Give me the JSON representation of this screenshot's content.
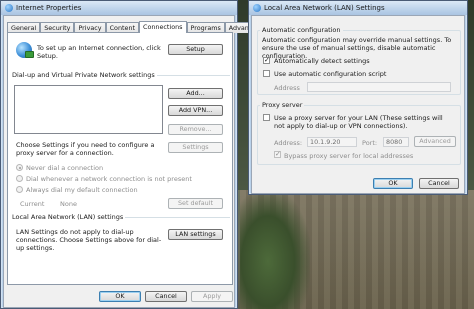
{
  "left_window": {
    "title": "Internet Properties",
    "tabs": [
      "General",
      "Security",
      "Privacy",
      "Content",
      "Connections",
      "Programs",
      "Advanced"
    ],
    "active_tab": "Connections",
    "setup_text": "To set up an Internet connection, click Setup.",
    "setup_button": "Setup",
    "dialup_group": "Dial-up and Virtual Private Network settings",
    "add_button": "Add...",
    "add_vpn_button": "Add VPN...",
    "remove_button": "Remove...",
    "settings_button": "Settings",
    "proxy_note": "Choose Settings if you need to configure a proxy server for a connection.",
    "radio_never": "Never dial a connection",
    "radio_dial_whenever": "Dial whenever a network connection is not present",
    "radio_always": "Always dial my default connection",
    "current_label": "Current",
    "current_value": "None",
    "set_default_button": "Set default",
    "lan_group": "Local Area Network (LAN) settings",
    "lan_note": "LAN Settings do not apply to dial-up connections. Choose Settings above for dial-up settings.",
    "lan_settings_button": "LAN settings",
    "ok_button": "OK",
    "cancel_button": "Cancel",
    "apply_button": "Apply"
  },
  "right_window": {
    "title": "Local Area Network (LAN) Settings",
    "auto_config_title": "Automatic configuration",
    "auto_config_note": "Automatic configuration may override manual settings.  To ensure the use of manual settings, disable automatic configuration.",
    "auto_detect_label": "Automatically detect settings",
    "auto_detect_checked": true,
    "auto_script_label": "Use automatic configuration script",
    "auto_script_checked": false,
    "address_label": "Address",
    "address_value": "",
    "proxy_title": "Proxy server",
    "use_proxy_label": "Use a proxy server for your LAN (These settings will not apply to dial-up or VPN connections).",
    "use_proxy_checked": false,
    "proxy_address_label": "Address:",
    "proxy_address_value": "10.1.9.20",
    "port_label": "Port:",
    "port_value": "8080",
    "advanced_button": "Advanced",
    "bypass_label": "Bypass proxy server for local addresses",
    "bypass_checked": true,
    "ok_button": "OK",
    "cancel_button": "Cancel"
  }
}
